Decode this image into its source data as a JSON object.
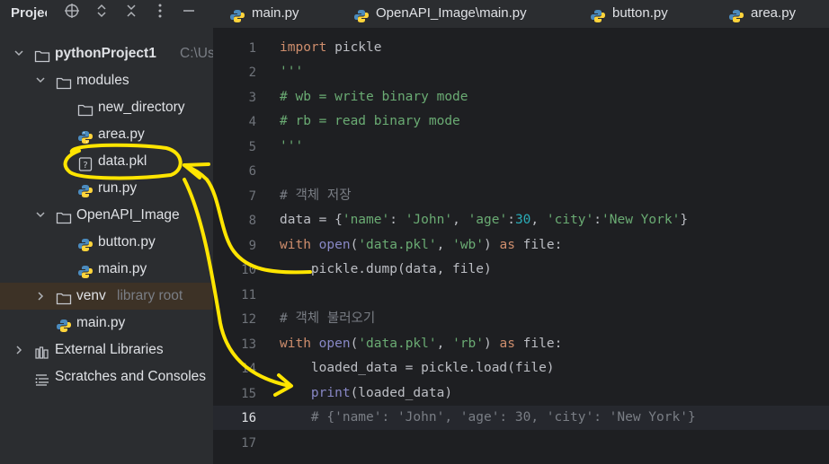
{
  "sidebar": {
    "title": "Project",
    "tools": {
      "target": "⊕",
      "expand": "⇕",
      "collapse": "✕",
      "more": "⋮",
      "hide": "—"
    },
    "items": [
      {
        "label": "pythonProject1",
        "suffix": "C:\\Us",
        "chevron": "⌄",
        "icon": "folder"
      },
      {
        "label": "modules",
        "suffix": "",
        "chevron": "⌄",
        "icon": "folder"
      },
      {
        "label": "new_directory",
        "suffix": "",
        "chevron": "",
        "icon": "folder"
      },
      {
        "label": "area.py",
        "suffix": "",
        "chevron": "",
        "icon": "python"
      },
      {
        "label": "data.pkl",
        "suffix": "",
        "chevron": "",
        "icon": "unknown-file"
      },
      {
        "label": "run.py",
        "suffix": "",
        "chevron": "",
        "icon": "python"
      },
      {
        "label": "OpenAPI_Image",
        "suffix": "",
        "chevron": "⌄",
        "icon": "folder"
      },
      {
        "label": "button.py",
        "suffix": "",
        "chevron": "",
        "icon": "python"
      },
      {
        "label": "main.py",
        "suffix": "",
        "chevron": "",
        "icon": "python"
      },
      {
        "label": "venv",
        "suffix": "library root",
        "chevron": "›",
        "icon": "folder"
      },
      {
        "label": "main.py",
        "suffix": "",
        "chevron": "",
        "icon": "python"
      },
      {
        "label": "External Libraries",
        "suffix": "",
        "chevron": "›",
        "icon": "library"
      },
      {
        "label": "Scratches and Consoles",
        "suffix": "",
        "chevron": "",
        "icon": "scratches"
      }
    ]
  },
  "tabs": [
    {
      "label": "main.py",
      "icon": "python"
    },
    {
      "label": "OpenAPI_Image\\main.py",
      "icon": "python"
    },
    {
      "label": "button.py",
      "icon": "python"
    },
    {
      "label": "area.py",
      "icon": "python"
    }
  ],
  "editor": {
    "line_numbers": [
      "1",
      "2",
      "3",
      "4",
      "5",
      "6",
      "7",
      "8",
      "9",
      "10",
      "11",
      "12",
      "13",
      "14",
      "15",
      "16",
      "17"
    ],
    "current_line": "16",
    "code": {
      "l1_kw": "import",
      "l1_rest": " pickle",
      "l2": "'''",
      "l3": "# wb = write binary mode",
      "l4": "# rb = read binary mode",
      "l5": "'''",
      "l7": "# 객체 저장",
      "l8_a": "data = {",
      "l8_s1": "'name'",
      "l8_b": ": ",
      "l8_s2": "'John'",
      "l8_c": ", ",
      "l8_s3": "'age'",
      "l8_d": ":",
      "l8_n": "30",
      "l8_e": ", ",
      "l8_s4": "'city'",
      "l8_f": ":",
      "l8_s5": "'New York'",
      "l8_g": "}",
      "l9_kw": "with",
      "l9_a": " ",
      "l9_bi": "open",
      "l9_b": "(",
      "l9_s1": "'data.pkl'",
      "l9_c": ", ",
      "l9_s2": "'wb'",
      "l9_d": ") ",
      "l9_kw2": "as",
      "l9_e": " file:",
      "l10": "    pickle.dump(data, file)",
      "l12": "# 객체 불러오기",
      "l13_kw": "with",
      "l13_a": " ",
      "l13_bi": "open",
      "l13_b": "(",
      "l13_s1": "'data.pkl'",
      "l13_c": ", ",
      "l13_s2": "'rb'",
      "l13_d": ") ",
      "l13_kw2": "as",
      "l13_e": " file:",
      "l14": "    loaded_data = pickle.load(file)",
      "l15_a": "    ",
      "l15_bi": "print",
      "l15_b": "(loaded_data)",
      "l16": "    # {'name': 'John', 'age': 30, 'city': 'New York'}"
    }
  },
  "colors": {
    "annotation": "#ffe500",
    "keyword": "#cf8e6d",
    "string": "#6aab73",
    "comment": "#7a7e85",
    "number": "#2aacb8",
    "builtin": "#8888c6"
  }
}
